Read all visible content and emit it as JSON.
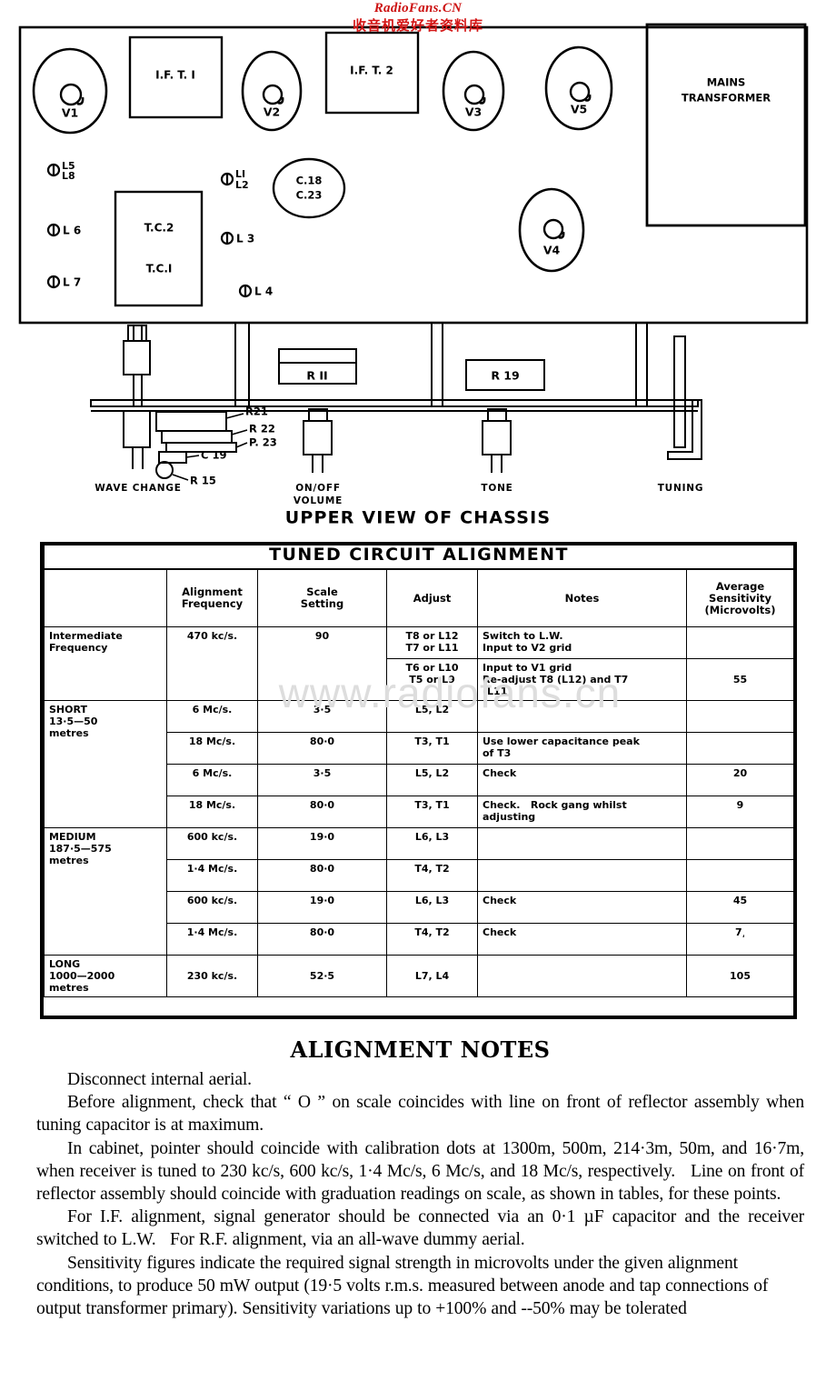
{
  "watermark": {
    "english": "RadioFans.CN",
    "chinese": "收音机爱好者资料库",
    "table_overlay": "www.radiofans.cn"
  },
  "chassis_diagram": {
    "caption": "UPPER VIEW OF CHASSIS",
    "valves": [
      {
        "id": "V1",
        "label": "V1"
      },
      {
        "id": "V2",
        "label": "V2"
      },
      {
        "id": "V3",
        "label": "V3"
      },
      {
        "id": "V5",
        "label": "V5"
      },
      {
        "id": "V4",
        "label": "V4"
      }
    ],
    "boxes": [
      {
        "id": "ift1",
        "label": "I.F. T. I"
      },
      {
        "id": "ift2",
        "label": "I.F. T. 2"
      },
      {
        "id": "mains",
        "label_line1": "MAINS",
        "label_line2": "TRANSFORMER"
      },
      {
        "id": "tc2",
        "label": "T.C.2"
      },
      {
        "id": "tc1",
        "label": "T.C.I"
      }
    ],
    "capacitor_oval": {
      "line1": "C.18",
      "line2": "C.23"
    },
    "coil_markers": [
      {
        "id": "L5L8",
        "line1": "L5",
        "line2": "L8"
      },
      {
        "id": "L6",
        "label": "L 6"
      },
      {
        "id": "L7",
        "label": "L 7"
      },
      {
        "id": "L1L2",
        "line1": "LI",
        "line2": "L2"
      },
      {
        "id": "L3",
        "label": "L 3"
      },
      {
        "id": "L4",
        "label": "L 4"
      }
    ],
    "underside_components": [
      {
        "id": "R11",
        "label": "R II"
      },
      {
        "id": "R19",
        "label": "R 19"
      },
      {
        "id": "R21",
        "label": "R21"
      },
      {
        "id": "R22",
        "label": "R 22"
      },
      {
        "id": "R23",
        "label": "P. 23"
      },
      {
        "id": "C19",
        "label": "C 19"
      },
      {
        "id": "R15",
        "label": "R 15"
      }
    ],
    "controls": [
      {
        "id": "wave-change",
        "label": "WAVE CHANGE"
      },
      {
        "id": "on-off-volume",
        "line1": "ON/OFF",
        "line2": "VOLUME"
      },
      {
        "id": "tone",
        "label": "TONE"
      },
      {
        "id": "tuning",
        "label": "TUNING"
      }
    ]
  },
  "alignment_table": {
    "title": "TUNED CIRCUIT ALIGNMENT",
    "headers": {
      "band": "",
      "frequency": "Alignment\nFrequency",
      "frequency_l1": "Alignment",
      "frequency_l2": "Frequency",
      "scale_l1": "Scale",
      "scale_l2": "Setting",
      "adjust": "Adjust",
      "notes": "Notes",
      "sens_l1": "Average",
      "sens_l2": "Sensitivity",
      "sens_l3": "(Microvolts)"
    },
    "rows": [
      {
        "band_l1": "Intermediate",
        "band_l2": "Frequency",
        "band_rowspan": 2,
        "frequency": "470 kc/s.",
        "freq_rowspan": 2,
        "scale": "90",
        "scale_rowspan": 2,
        "adjust_l1": "T8 or L12",
        "adjust_l2": "T7 or L11",
        "notes_l1": "Switch to L.W.",
        "notes_l2": "Input to V2 grid",
        "sensitivity": ""
      },
      {
        "adjust_l1": "T6 or L10",
        "adjust_l2": "T5 or L9",
        "notes_l1": "Input to V1 grid",
        "notes_l2": "Re-adjust T8 (L12) and T7",
        "notes_l3": "(L11)",
        "sensitivity": "55"
      },
      {
        "band_l1": "SHORT",
        "band_l2": "13·5—50",
        "band_l3": "metres",
        "band_rowspan": 4,
        "frequency": "6 Mc/s.",
        "scale": "3·5",
        "adjust": "L5, L2",
        "notes": "",
        "sensitivity": ""
      },
      {
        "frequency": "18 Mc/s.",
        "scale": "80·0",
        "adjust": "T3, T1",
        "notes_l1": "Use lower capacitance peak",
        "notes_l2": "of T3",
        "sensitivity": ""
      },
      {
        "frequency": "6 Mc/s.",
        "scale": "3·5",
        "adjust": "L5, L2",
        "notes": "Check",
        "sensitivity": "20"
      },
      {
        "frequency": "18 Mc/s.",
        "scale": "80·0",
        "adjust": "T3, T1",
        "notes_l1": "Check.   Rock gang whilst",
        "notes_l2": "adjusting",
        "sensitivity": "9"
      },
      {
        "band_l1": "MEDIUM",
        "band_l2": "187·5—575",
        "band_l3": "metres",
        "band_rowspan": 4,
        "frequency": "600 kc/s.",
        "scale": "19·0",
        "adjust": "L6, L3",
        "notes": "",
        "sensitivity": ""
      },
      {
        "frequency": "1·4 Mc/s.",
        "scale": "80·0",
        "adjust": "T4, T2",
        "notes": "",
        "sensitivity": ""
      },
      {
        "frequency": "600 kc/s.",
        "scale": "19·0",
        "adjust": "L6, L3",
        "notes": "Check",
        "sensitivity": "45"
      },
      {
        "frequency": "1·4 Mc/s.",
        "scale": "80·0",
        "adjust": "T4, T2",
        "notes": "Check",
        "sensitivity": "7͵"
      },
      {
        "band_l1": "LONG",
        "band_l2": "1000—2000",
        "band_l3": "metres",
        "band_rowspan": 1,
        "frequency": "230 kc/s.",
        "scale": "52·5",
        "adjust": "L7, L4",
        "notes": "",
        "sensitivity": "105"
      }
    ]
  },
  "alignment_notes": {
    "title": "ALIGNMENT NOTES",
    "paragraphs": [
      "Disconnect internal aerial.",
      "Before alignment, check that “ O ” on scale coincides with line on front of reflector assembly when tuning capacitor is at maximum.",
      "In cabinet, pointer should coincide with calibration dots at 1300m, 500m, 214·3m, 50m, and 16·7m, when receiver is tuned to 230 kc/s, 600 kc/s, 1·4 Mc/s, 6 Mc/s, and 18 Mc/s, respectively.   Line on front of reflector assembly should coincide with graduation readings on scale, as shown in tables, for these points.",
      "For I.F. alignment, signal generator should be connected via an 0·1 µF capacitor and the receiver switched to L.W.   For R.F. alignment, via an all-wave dummy aerial.",
      "Sensitivity figures indicate the required signal strength in microvolts under the given alignment conditions, to produce 50 mW output (19·5 volts r.m.s. measured between anode and tap connections of output transformer primary). Sensitivity variations up to +100% and --50% may be tolerated"
    ]
  }
}
